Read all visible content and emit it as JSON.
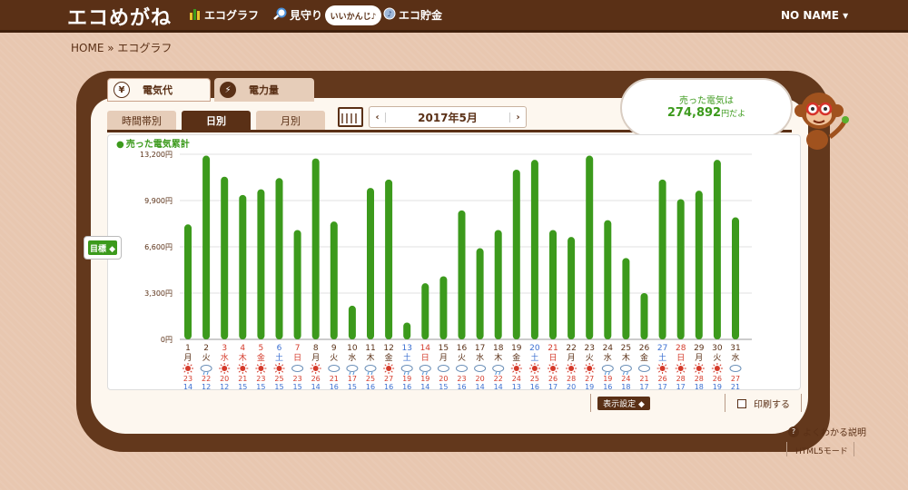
{
  "header": {
    "logo": "エコめがね",
    "nav": [
      {
        "label": "エコグラフ",
        "icon": "bar-chart-icon"
      },
      {
        "label": "見守り",
        "icon": "magnifier-icon"
      },
      {
        "label": "エコ貯金",
        "icon": "coin-icon"
      }
    ],
    "bubble": "いいかんじ♪",
    "user": "NO NAME ▾"
  },
  "breadcrumb": "HOME » エコグラフ",
  "tabs": {
    "main": [
      "電気代",
      "電力量"
    ],
    "main_icons": [
      "¥",
      "⚡"
    ],
    "sub": [
      "時間帯別",
      "日別",
      "月別"
    ]
  },
  "date": {
    "label": "2017年5月",
    "prev": "‹",
    "next": "›"
  },
  "cloud": {
    "line1": "売った電気は",
    "amount": "274,892",
    "suffix": "円だよ"
  },
  "controls": {
    "goal": "目標 ◆",
    "display": "表示設定 ◆",
    "print": "印刷する",
    "help": "よくわかる説明",
    "html5": "HTML5モード"
  },
  "colors": {
    "bar": "#3c9a1c",
    "brown": "#5a3016",
    "sat": "#3b6fd1",
    "sun": "#d43a2a"
  },
  "chart_data": {
    "type": "bar",
    "title": "売った電気累計",
    "y_ticks": [
      "0円",
      "3,300円",
      "6,600円",
      "9,900円",
      "13,200円"
    ],
    "ylim": [
      0,
      13200
    ],
    "categories": [
      "1",
      "2",
      "3",
      "4",
      "5",
      "6",
      "7",
      "8",
      "9",
      "10",
      "11",
      "12",
      "13",
      "14",
      "15",
      "16",
      "17",
      "18",
      "19",
      "20",
      "21",
      "22",
      "23",
      "24",
      "25",
      "26",
      "27",
      "28",
      "29",
      "30",
      "31"
    ],
    "weekdays": [
      "月",
      "火",
      "水",
      "木",
      "金",
      "土",
      "日",
      "月",
      "火",
      "水",
      "木",
      "金",
      "土",
      "日",
      "月",
      "火",
      "水",
      "木",
      "金",
      "土",
      "日",
      "月",
      "火",
      "水",
      "木",
      "金",
      "土",
      "日",
      "月",
      "火",
      "水"
    ],
    "day_types": [
      "w",
      "w",
      "h",
      "h",
      "h",
      "s",
      "h",
      "w",
      "w",
      "w",
      "w",
      "w",
      "s",
      "h",
      "w",
      "w",
      "w",
      "w",
      "w",
      "s",
      "h",
      "w",
      "w",
      "w",
      "w",
      "w",
      "s",
      "h",
      "w",
      "w",
      "w"
    ],
    "values": [
      8200,
      13100,
      11600,
      10300,
      10700,
      11500,
      7800,
      12900,
      8400,
      2400,
      10800,
      11400,
      1200,
      4000,
      4500,
      9200,
      6500,
      7800,
      12100,
      12800,
      7800,
      7300,
      13100,
      8500,
      5800,
      3300,
      11400,
      10000,
      10600,
      12800,
      8700
    ],
    "weather": [
      "sun",
      "cloud-rain",
      "sun",
      "sun",
      "sun",
      "sun",
      "cloud",
      "sun",
      "cloud",
      "cloud-rain",
      "cloud-rain",
      "sun",
      "cloud-rain",
      "cloud-rain",
      "cloud",
      "cloud",
      "cloud",
      "cloud-rain",
      "sun",
      "sun",
      "sun",
      "sun",
      "sun",
      "cloud-rain",
      "cloud-rain",
      "cloud",
      "sun",
      "sun",
      "sun",
      "sun",
      "cloud"
    ],
    "high": [
      23,
      22,
      20,
      21,
      23,
      25,
      23,
      26,
      21,
      17,
      25,
      27,
      19,
      19,
      20,
      23,
      20,
      22,
      24,
      25,
      26,
      28,
      27,
      19,
      24,
      21,
      26,
      28,
      28,
      26,
      27
    ],
    "low": [
      14,
      12,
      12,
      15,
      15,
      15,
      15,
      14,
      16,
      15,
      16,
      16,
      16,
      14,
      15,
      16,
      14,
      14,
      13,
      16,
      17,
      20,
      19,
      16,
      18,
      17,
      17,
      17,
      18,
      19,
      21
    ]
  }
}
